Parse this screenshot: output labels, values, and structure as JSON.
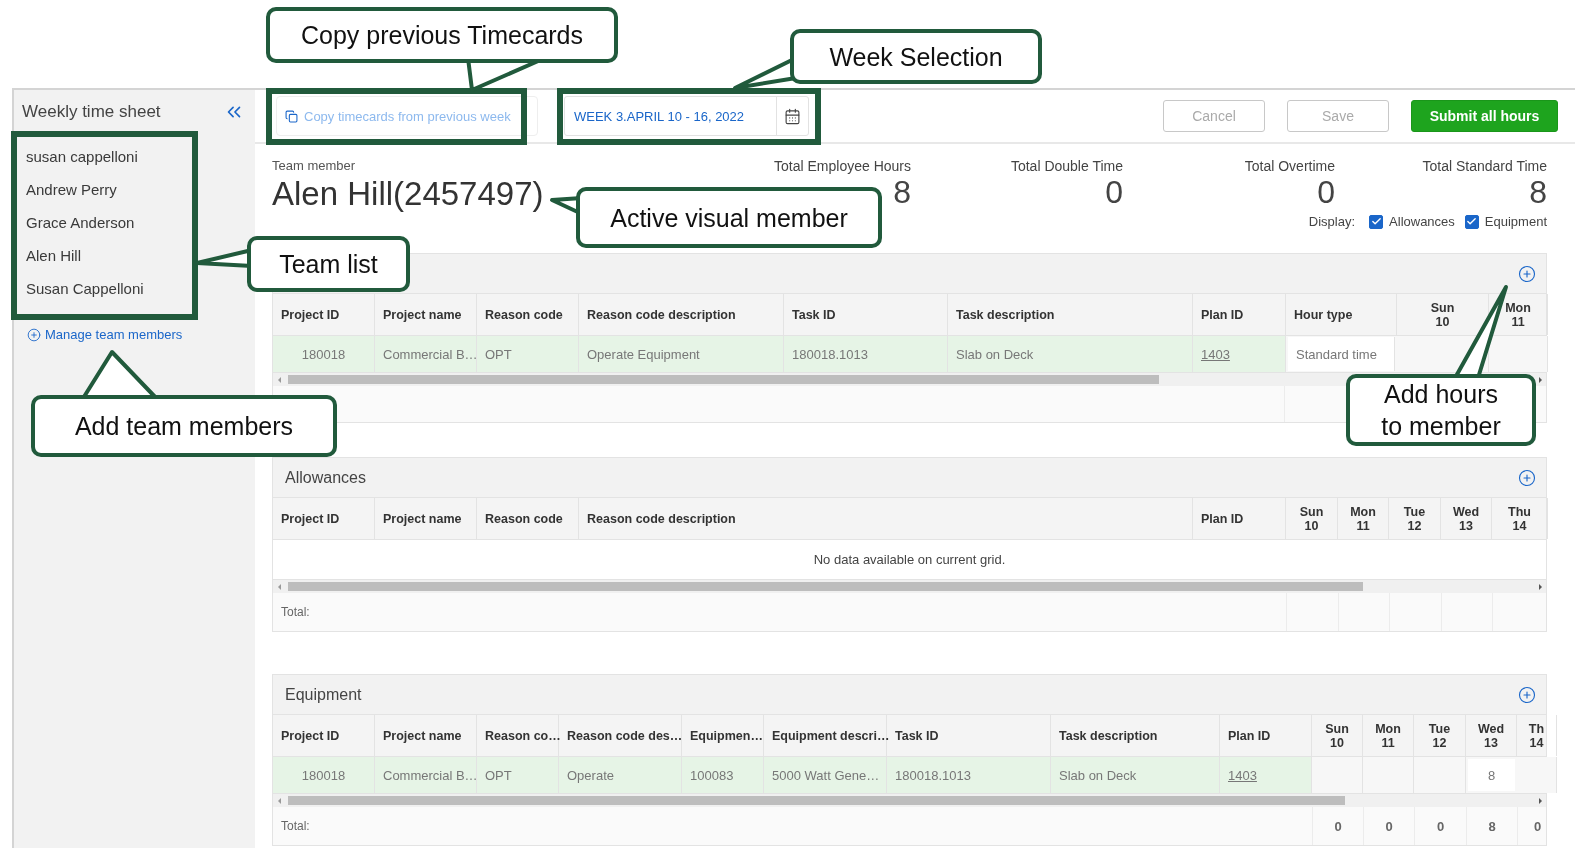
{
  "sidebar": {
    "title": "Weekly time sheet",
    "team": [
      {
        "name": "susan cappelloni"
      },
      {
        "name": "Andrew Perry"
      },
      {
        "name": "Grace Anderson"
      },
      {
        "name": "Alen Hill"
      },
      {
        "name": "Susan Cappelloni"
      }
    ],
    "manage_link": "Manage team members"
  },
  "toolbar": {
    "copy_button": "Copy timecards from previous week",
    "week": "WEEK 3.APRIL 10 - 16, 2022",
    "buttons": [
      {
        "label": "Cancel",
        "kind": "secondary"
      },
      {
        "label": "Save",
        "kind": "secondary"
      },
      {
        "label": "Submit all hours",
        "kind": "primary"
      }
    ]
  },
  "member": {
    "label": "Team member",
    "name": "Alen Hill(2457497)"
  },
  "totals": [
    {
      "label": "Total Employee Hours",
      "value": "8"
    },
    {
      "label": "Total Double Time",
      "value": "0"
    },
    {
      "label": "Total Overtime",
      "value": "0"
    },
    {
      "label": "Total Standard Time",
      "value": "8"
    }
  ],
  "display": {
    "label": "Display:",
    "options": [
      {
        "label": "Allowances",
        "checked": true
      },
      {
        "label": "Equipment",
        "checked": true
      }
    ]
  },
  "sections": [
    {
      "kind": "hours",
      "columns": [
        {
          "label": "Project ID"
        },
        {
          "label": "Project name"
        },
        {
          "label": "Reason code"
        },
        {
          "label": "Reason code description"
        },
        {
          "label": "Task ID"
        },
        {
          "label": "Task description"
        },
        {
          "label": "Plan ID"
        },
        {
          "label": "Hour type"
        },
        {
          "label": "Sun",
          "date": "10"
        },
        {
          "label": "Mon",
          "date": "11"
        }
      ],
      "rows": [
        {
          "cells": [
            {
              "kind": "id",
              "text": "180018"
            },
            {
              "kind": "text",
              "text": "Commercial B…"
            },
            {
              "kind": "text",
              "text": "OPT"
            },
            {
              "kind": "text",
              "text": "Operate Equipment"
            },
            {
              "kind": "text",
              "text": "180018.1013"
            },
            {
              "kind": "text",
              "text": "Slab on Deck"
            },
            {
              "kind": "link",
              "text": "1403"
            },
            {
              "kind": "input",
              "text": "Standard time"
            },
            {
              "kind": "day"
            },
            {
              "kind": "day"
            }
          ]
        }
      ]
    },
    {
      "kind": "allowances",
      "title": "Allowances",
      "columns": [
        {
          "label": "Project ID"
        },
        {
          "label": "Project name"
        },
        {
          "label": "Reason code"
        },
        {
          "label": "Reason code description"
        },
        {
          "label": "Plan ID"
        },
        {
          "label": "Sun",
          "date": "10"
        },
        {
          "label": "Mon",
          "date": "11"
        },
        {
          "label": "Tue",
          "date": "12"
        },
        {
          "label": "Wed",
          "date": "13"
        },
        {
          "label": "Thu",
          "date": "14"
        }
      ],
      "message": "No data available on current grid.",
      "total": {
        "label": "Total:"
      }
    },
    {
      "kind": "equipment",
      "title": "Equipment",
      "columns": [
        {
          "label": "Project ID"
        },
        {
          "label": "Project name"
        },
        {
          "label": "Reason co…"
        },
        {
          "label": "Reason code des…"
        },
        {
          "label": "Equipmen…"
        },
        {
          "label": "Equipment descri…"
        },
        {
          "label": "Task ID"
        },
        {
          "label": "Task description"
        },
        {
          "label": "Plan ID"
        },
        {
          "label": "Sun",
          "date": "10"
        },
        {
          "label": "Mon",
          "date": "11"
        },
        {
          "label": "Tue",
          "date": "12"
        },
        {
          "label": "Wed",
          "date": "13"
        },
        {
          "label": "Th",
          "date": "14"
        }
      ],
      "rows": [
        {
          "cells": [
            {
              "kind": "id",
              "text": "180018"
            },
            {
              "kind": "text",
              "text": "Commercial B…"
            },
            {
              "kind": "text",
              "text": "OPT"
            },
            {
              "kind": "text",
              "text": "Operate"
            },
            {
              "kind": "text",
              "text": "100083"
            },
            {
              "kind": "text",
              "text": "5000 Watt Gene…"
            },
            {
              "kind": "text",
              "text": "180018.1013"
            },
            {
              "kind": "text",
              "text": "Slab on Deck"
            },
            {
              "kind": "link",
              "text": "1403"
            },
            {
              "kind": "day"
            },
            {
              "kind": "day"
            },
            {
              "kind": "day"
            },
            {
              "kind": "input",
              "text": "8"
            },
            {
              "kind": "day"
            }
          ]
        }
      ],
      "total": {
        "label": "Total:",
        "values": [
          "0",
          "0",
          "0",
          "8",
          "0"
        ]
      }
    }
  ],
  "callouts": [
    {
      "text": "Copy previous Timecards"
    },
    {
      "text": "Week Selection"
    },
    {
      "text": "Active visual member"
    },
    {
      "text": "Team list"
    },
    {
      "text": "Add team members"
    },
    {
      "text": "Add hours\nto member"
    }
  ]
}
